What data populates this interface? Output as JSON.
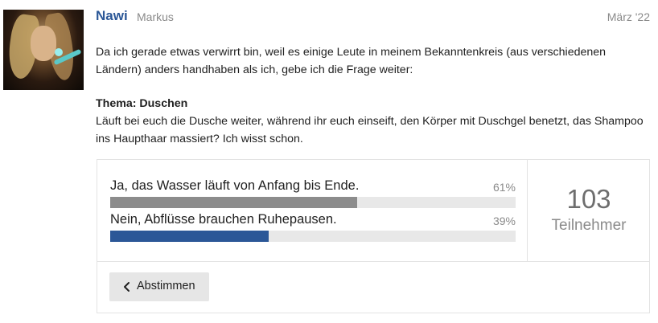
{
  "post": {
    "author": "Nawi",
    "subtitle": "Markus",
    "date": "März '22",
    "intro": "Da ich gerade etwas verwirrt bin, weil es einige Leute in meinem Bekanntenkreis (aus verschiedenen Ländern) anders handhaben als ich, gebe ich die Frage weiter:",
    "topic_title": "Thema: Duschen",
    "topic_body": "Läuft bei euch die Dusche weiter, während ihr euch einseift, den Körper mit Duschgel benetzt, das Shampoo ins Haupthaar massiert? Ich wisst schon."
  },
  "poll": {
    "options": [
      {
        "label": "Ja, das Wasser läuft von Anfang bis Ende.",
        "percent_text": "61%",
        "fraction": 0.61,
        "color": "#8c8c8c"
      },
      {
        "label": "Nein, Abflüsse brauchen Ruhepausen.",
        "percent_text": "39%",
        "fraction": 0.39,
        "color": "#2b5797"
      }
    ],
    "participants_count": "103",
    "participants_label": "Teilnehmer",
    "vote_button_label": "Abstimmen",
    "vote_button_icon": "chevron-left-icon"
  },
  "colors": {
    "author": "#2b5797",
    "muted": "#8a8a8a",
    "track": "#e8e8e8"
  }
}
